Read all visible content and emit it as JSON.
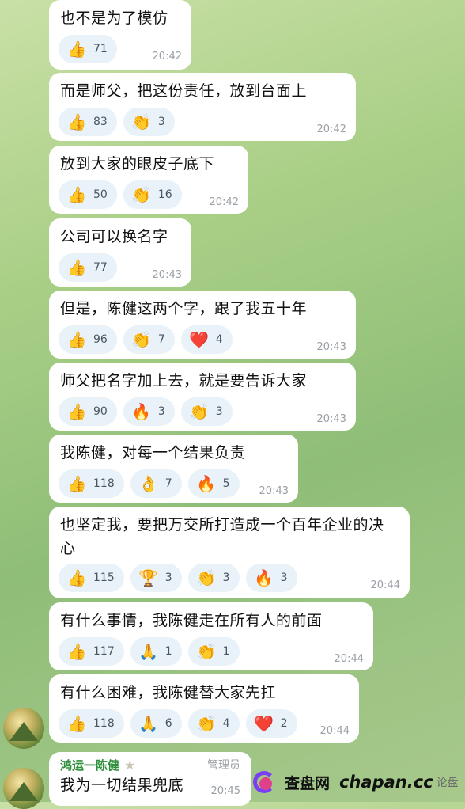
{
  "messages": [
    {
      "text": "也不是为了模仿",
      "time": "20:42",
      "reactions": [
        {
          "icon": "thumbs-up",
          "glyph": "👍",
          "count": "71"
        }
      ]
    },
    {
      "text": "而是师父，把这份责任，放到台面上",
      "time": "20:42",
      "reactions": [
        {
          "icon": "thumbs-up",
          "glyph": "👍",
          "count": "83"
        },
        {
          "icon": "clapping-hands",
          "glyph": "👏",
          "count": "3"
        }
      ]
    },
    {
      "text": "放到大家的眼皮子底下",
      "time": "20:42",
      "reactions": [
        {
          "icon": "thumbs-up",
          "glyph": "👍",
          "count": "50"
        },
        {
          "icon": "clapping-hands",
          "glyph": "👏",
          "count": "16"
        }
      ]
    },
    {
      "text": "公司可以换名字",
      "time": "20:43",
      "reactions": [
        {
          "icon": "thumbs-up",
          "glyph": "👍",
          "count": "77"
        }
      ]
    },
    {
      "text": "但是，陈健这两个字，跟了我五十年",
      "time": "20:43",
      "reactions": [
        {
          "icon": "thumbs-up",
          "glyph": "👍",
          "count": "96"
        },
        {
          "icon": "clapping-hands",
          "glyph": "👏",
          "count": "7"
        },
        {
          "icon": "red-heart",
          "glyph": "❤️",
          "count": "4"
        }
      ]
    },
    {
      "text": "师父把名字加上去，就是要告诉大家",
      "time": "20:43",
      "reactions": [
        {
          "icon": "thumbs-up",
          "glyph": "👍",
          "count": "90"
        },
        {
          "icon": "fire",
          "glyph": "🔥",
          "count": "3"
        },
        {
          "icon": "clapping-hands",
          "glyph": "👏",
          "count": "3"
        }
      ]
    },
    {
      "text": "我陈健，对每一个结果负责",
      "time": "20:43",
      "reactions": [
        {
          "icon": "thumbs-up",
          "glyph": "👍",
          "count": "118"
        },
        {
          "icon": "ok-hand",
          "glyph": "👌",
          "count": "7"
        },
        {
          "icon": "fire",
          "glyph": "🔥",
          "count": "5"
        }
      ]
    },
    {
      "text": "也坚定我，要把万交所打造成一个百年企业的决心",
      "time": "20:44",
      "reactions": [
        {
          "icon": "thumbs-up",
          "glyph": "👍",
          "count": "115"
        },
        {
          "icon": "trophy",
          "glyph": "🏆",
          "count": "3"
        },
        {
          "icon": "clapping-hands",
          "glyph": "👏",
          "count": "3"
        },
        {
          "icon": "fire",
          "glyph": "🔥",
          "count": "3"
        }
      ]
    },
    {
      "text": "有什么事情，我陈健走在所有人的前面",
      "time": "20:44",
      "reactions": [
        {
          "icon": "thumbs-up",
          "glyph": "👍",
          "count": "117"
        },
        {
          "icon": "folded-hands",
          "glyph": "🙏",
          "count": "1"
        },
        {
          "icon": "clapping-hands",
          "glyph": "👏",
          "count": "1"
        }
      ]
    },
    {
      "text": "有什么困难，我陈健替大家先扛",
      "time": "20:44",
      "reactions": [
        {
          "icon": "thumbs-up",
          "glyph": "👍",
          "count": "118"
        },
        {
          "icon": "folded-hands",
          "glyph": "🙏",
          "count": "6"
        },
        {
          "icon": "clapping-hands",
          "glyph": "👏",
          "count": "4"
        },
        {
          "icon": "red-heart",
          "glyph": "❤️",
          "count": "2"
        }
      ]
    }
  ],
  "last_message": {
    "sender": "鸿运一陈健",
    "role": "管理员",
    "text": "我为一切结果兜底",
    "time": "20:45"
  },
  "watermark": {
    "site": "查盘网",
    "url": "chapan.cc",
    "forum": "论盘"
  },
  "colors": {
    "bubble": "#ffffff",
    "reaction_pill": "#e9f2f8",
    "time_text": "#9aa0a6",
    "sender_name": "#2f8f3a"
  }
}
